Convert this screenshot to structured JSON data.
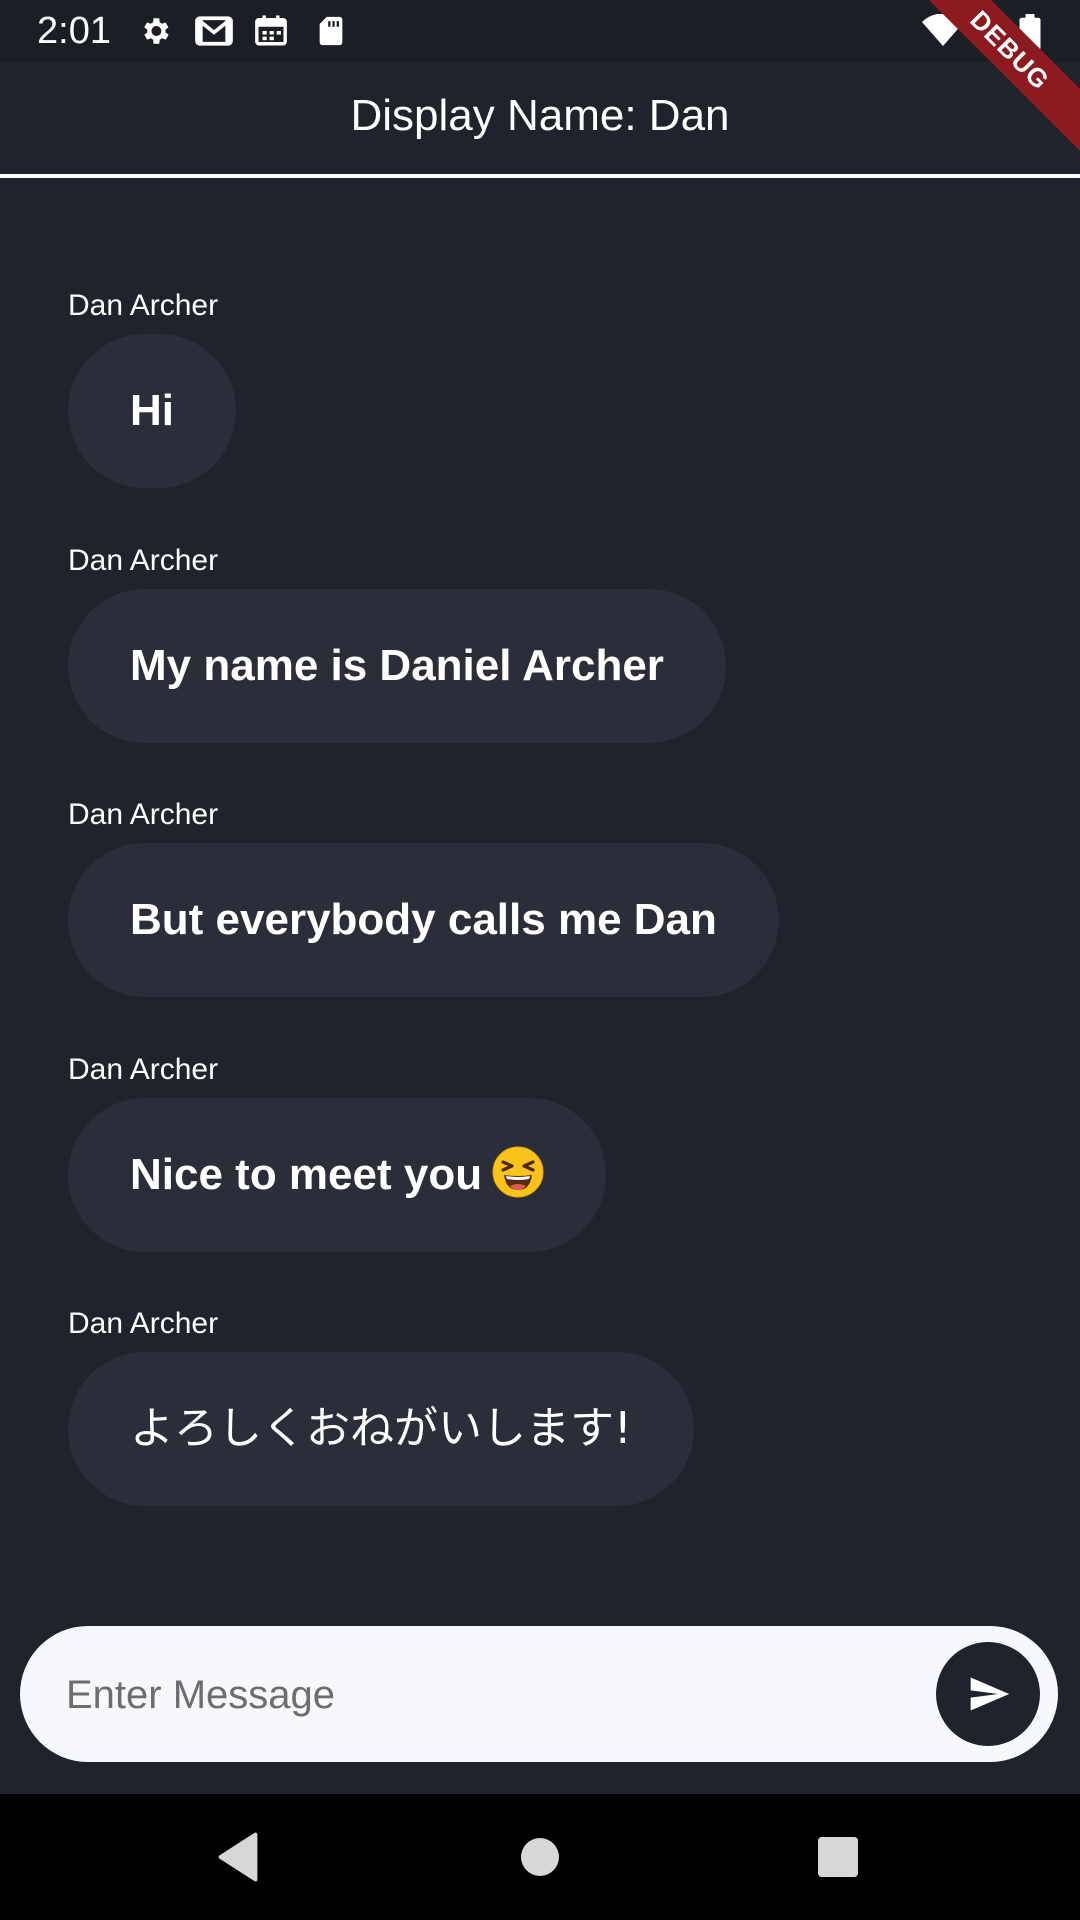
{
  "status_bar": {
    "time": "2:01",
    "left_icons": [
      "gear-icon",
      "gmail-icon",
      "calendar-icon",
      "sd-card-icon"
    ],
    "right_icons": [
      "wifi-icon",
      "cell-signal-icon",
      "battery-icon"
    ],
    "debug_label": "DEBUG"
  },
  "app_bar": {
    "title": "Display Name: Dan"
  },
  "messages": [
    {
      "sender": "Dan Archer",
      "text": "Hi"
    },
    {
      "sender": "Dan Archer",
      "text": "My name is Daniel Archer"
    },
    {
      "sender": "Dan Archer",
      "text": "But everybody calls me Dan"
    },
    {
      "sender": "Dan Archer",
      "text": "Nice to meet you",
      "emoji": "laughing-face-emoji"
    },
    {
      "sender": "Dan Archer",
      "text": "よろしくおねがいします!"
    }
  ],
  "input": {
    "placeholder": "Enter Message",
    "value": ""
  },
  "send_button": {
    "icon": "send-icon"
  },
  "nav_bar": {
    "buttons": [
      "back-icon",
      "home-icon",
      "recents-icon"
    ]
  },
  "colors": {
    "background": "#1f232b",
    "bubble": "#2b2e38",
    "input_background": "#f7f8fd",
    "debug_banner": "#8c1a1f"
  }
}
